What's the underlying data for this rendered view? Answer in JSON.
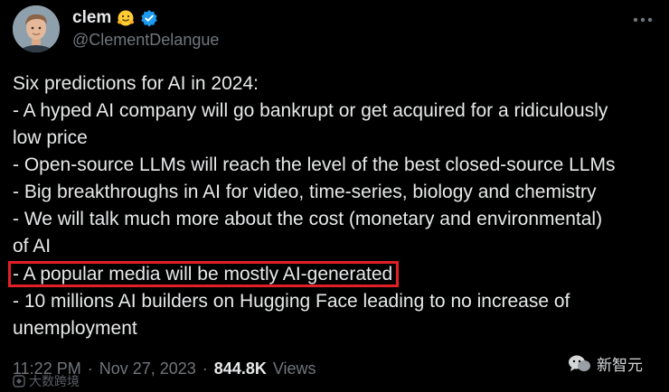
{
  "author": {
    "display_name": "clem",
    "emoji": "hugging-face-emoji",
    "handle": "@ClementDelangue",
    "verified": true
  },
  "tweet": {
    "lines": [
      "Six predictions for AI in 2024:",
      "- A hyped AI company will go bankrupt or get acquired for a ridiculously",
      "low price",
      "- Open-source LLMs will reach the level of the best closed-source LLMs",
      "- Big breakthroughs in AI for video, time-series, biology and chemistry",
      "- We will talk much more about the cost (monetary and environmental)",
      "of AI",
      "- A popular media will be mostly AI-generated",
      "- 10 millions AI builders on Hugging Face leading to no increase of",
      "unemployment"
    ],
    "highlighted_line_index": 7
  },
  "meta": {
    "time": "11:22 PM",
    "separator": "·",
    "date": "Nov 27, 2023",
    "views_count": "844.8K",
    "views_label": "Views"
  },
  "watermarks": {
    "left_text": "大数跨境",
    "right_text": "新智元"
  },
  "colors": {
    "background": "#000000",
    "text": "#e7e9ea",
    "secondary": "#71767b",
    "verified": "#1d9bf0",
    "highlight_border": "#e21f26"
  }
}
